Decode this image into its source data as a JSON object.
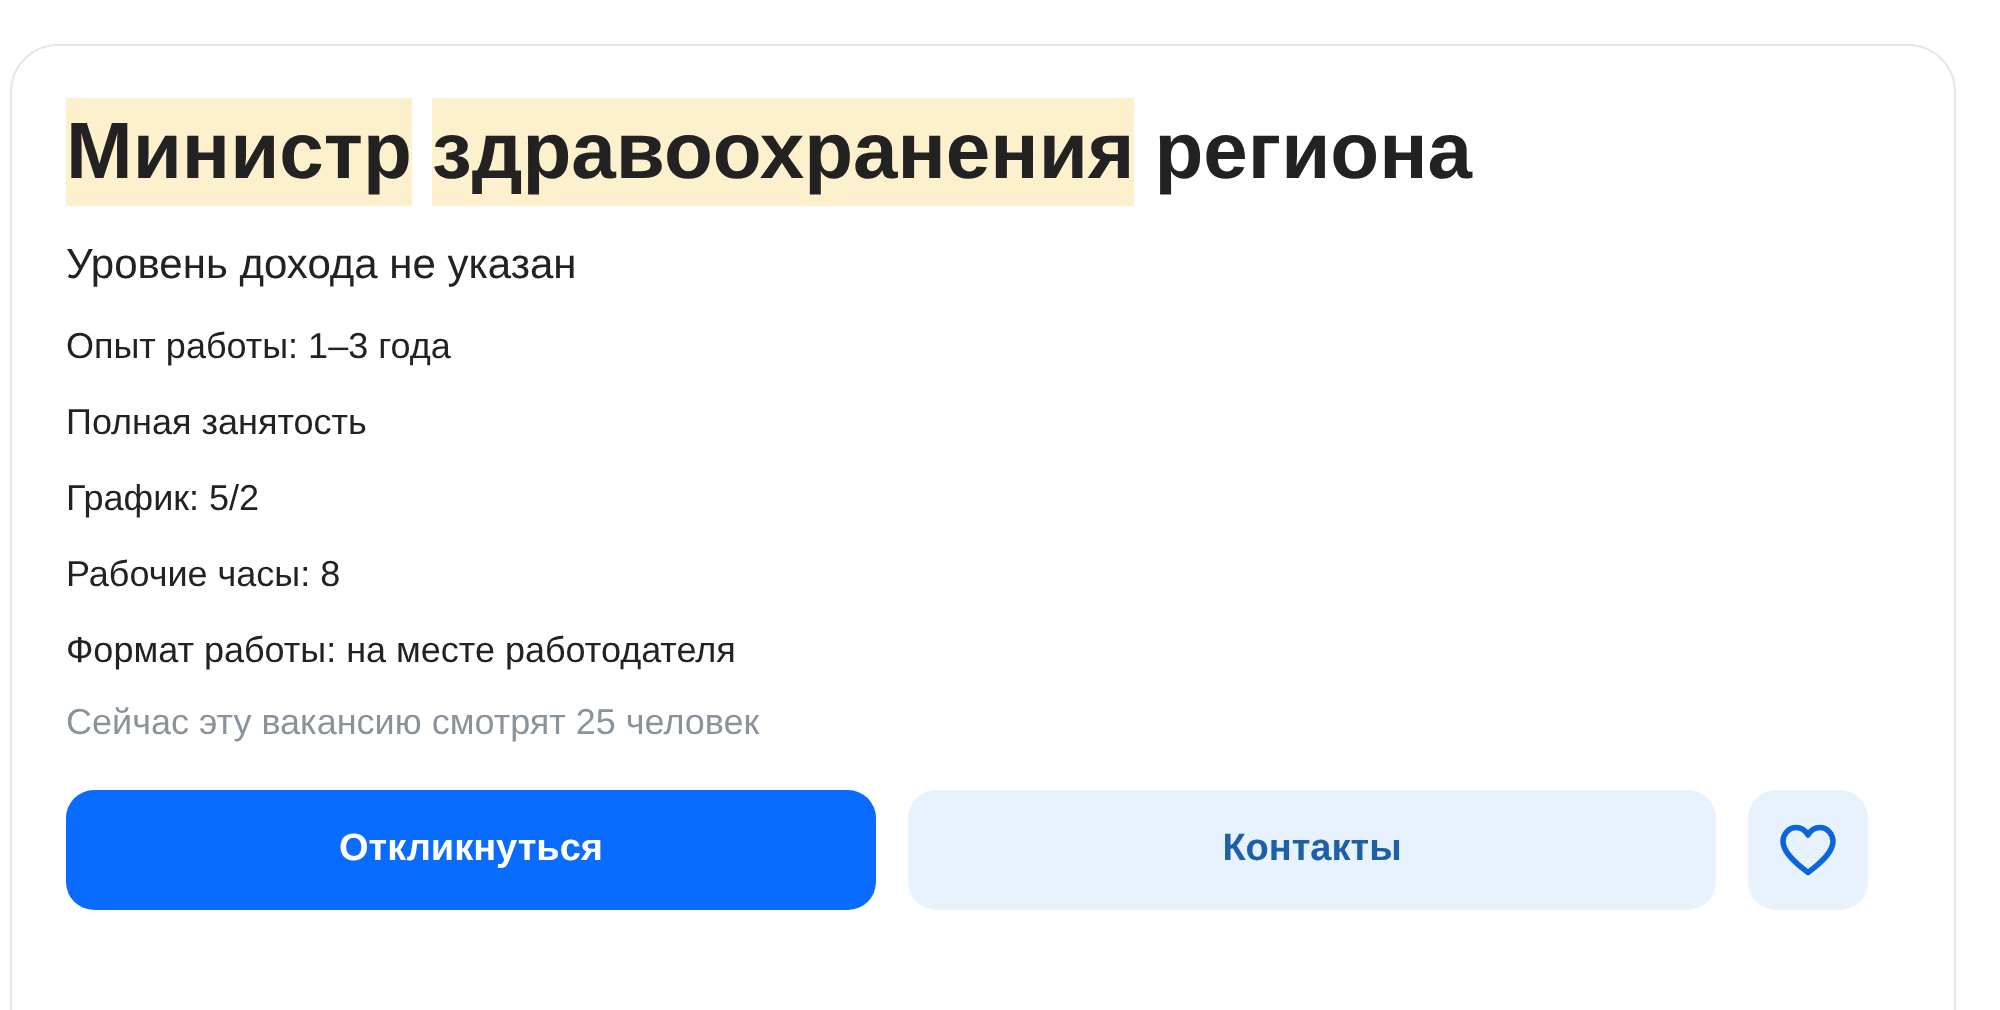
{
  "title": [
    {
      "text": "Министр",
      "highlighted": true
    },
    {
      "text": "здравоохранения",
      "highlighted": true
    },
    {
      "text": "региона",
      "highlighted": false
    }
  ],
  "salary": "Уровень дохода не указан",
  "details": [
    "Опыт работы: 1–3 года",
    "Полная занятость",
    "График: 5/2",
    "Рабочие часы: 8",
    "Формат работы: на месте работодателя"
  ],
  "viewers": "Сейчас эту вакансию смотрят 25 человек",
  "buttons": [
    {
      "label": "Откликнуться",
      "kind": "primary"
    },
    {
      "label": "Контакты",
      "kind": "secondary"
    },
    {
      "kind": "favorite"
    }
  ]
}
